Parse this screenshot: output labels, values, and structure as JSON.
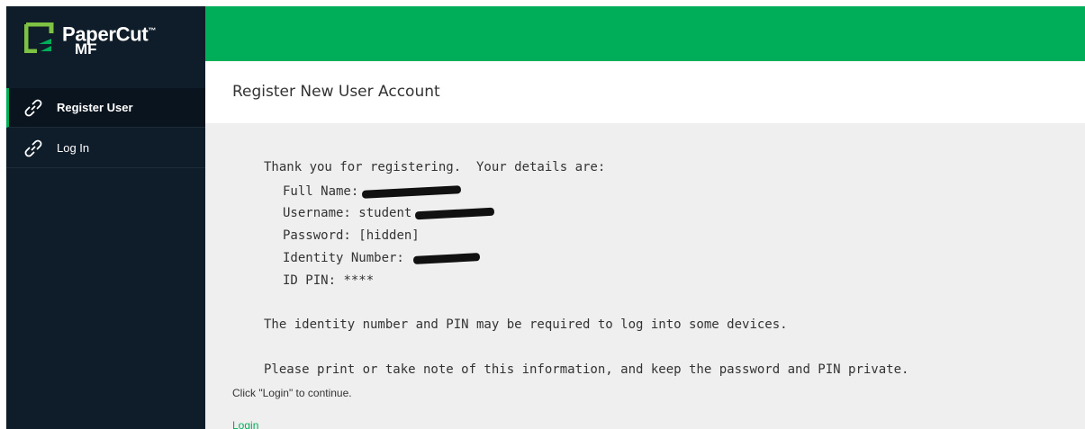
{
  "brand": {
    "name": "PaperCut",
    "trademark": "™",
    "product": "MF",
    "logo_icon": "papercut-logo-icon",
    "accent_color": "#00ae5a",
    "sidebar_color": "#0f1c29"
  },
  "sidebar": {
    "items": [
      {
        "label": "Register User",
        "icon": "link-icon",
        "active": true
      },
      {
        "label": "Log In",
        "icon": "link-icon",
        "active": false
      }
    ]
  },
  "page": {
    "title": "Register New User Account"
  },
  "message": {
    "intro": "Thank you for registering.  Your details are:",
    "full_name_label": "Full Name:",
    "username_label": "Username:",
    "username_value": "student",
    "password_label": "Password:",
    "password_value": "[hidden]",
    "identity_label": "Identity Number:",
    "pin_label": "ID PIN:",
    "pin_value": "****",
    "note1": "The identity number and PIN may be required to log into some devices.",
    "note2": "Please print or take note of this information, and keep the password and PIN private."
  },
  "footer": {
    "continue_text": "Click \"Login\" to continue.",
    "login_link": "Login"
  }
}
